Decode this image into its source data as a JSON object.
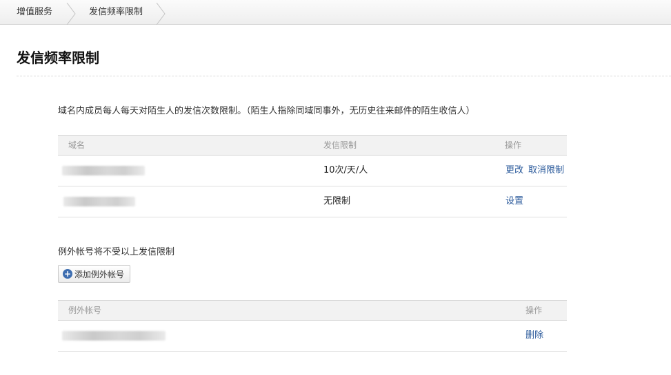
{
  "breadcrumb": {
    "items": [
      {
        "label": "增值服务"
      },
      {
        "label": "发信频率限制"
      }
    ]
  },
  "page": {
    "title": "发信频率限制",
    "description": "域名内成员每人每天对陌生人的发信次数限制。（陌生人指除同域同事外，无历史往来邮件的陌生收信人）"
  },
  "domain_table": {
    "headers": [
      "域名",
      "发信限制",
      "操作"
    ],
    "rows": [
      {
        "limit": "10次/天/人",
        "actions": [
          "更改",
          "取消限制"
        ]
      },
      {
        "limit": "无限制",
        "actions": [
          "设置"
        ]
      }
    ]
  },
  "exempt": {
    "label": "例外帐号将不受以上发信限制",
    "add_button": "添加例外帐号",
    "headers": [
      "例外帐号",
      "操作"
    ],
    "rows": [
      {
        "action": "删除"
      }
    ]
  },
  "colors": {
    "link": "#2b5a9b",
    "header_bg": "#f2f2f2",
    "accent": "#3d6db0"
  },
  "icons": {
    "add": "plus-circle-icon",
    "breadcrumb_separator": "chevron-right-icon"
  }
}
